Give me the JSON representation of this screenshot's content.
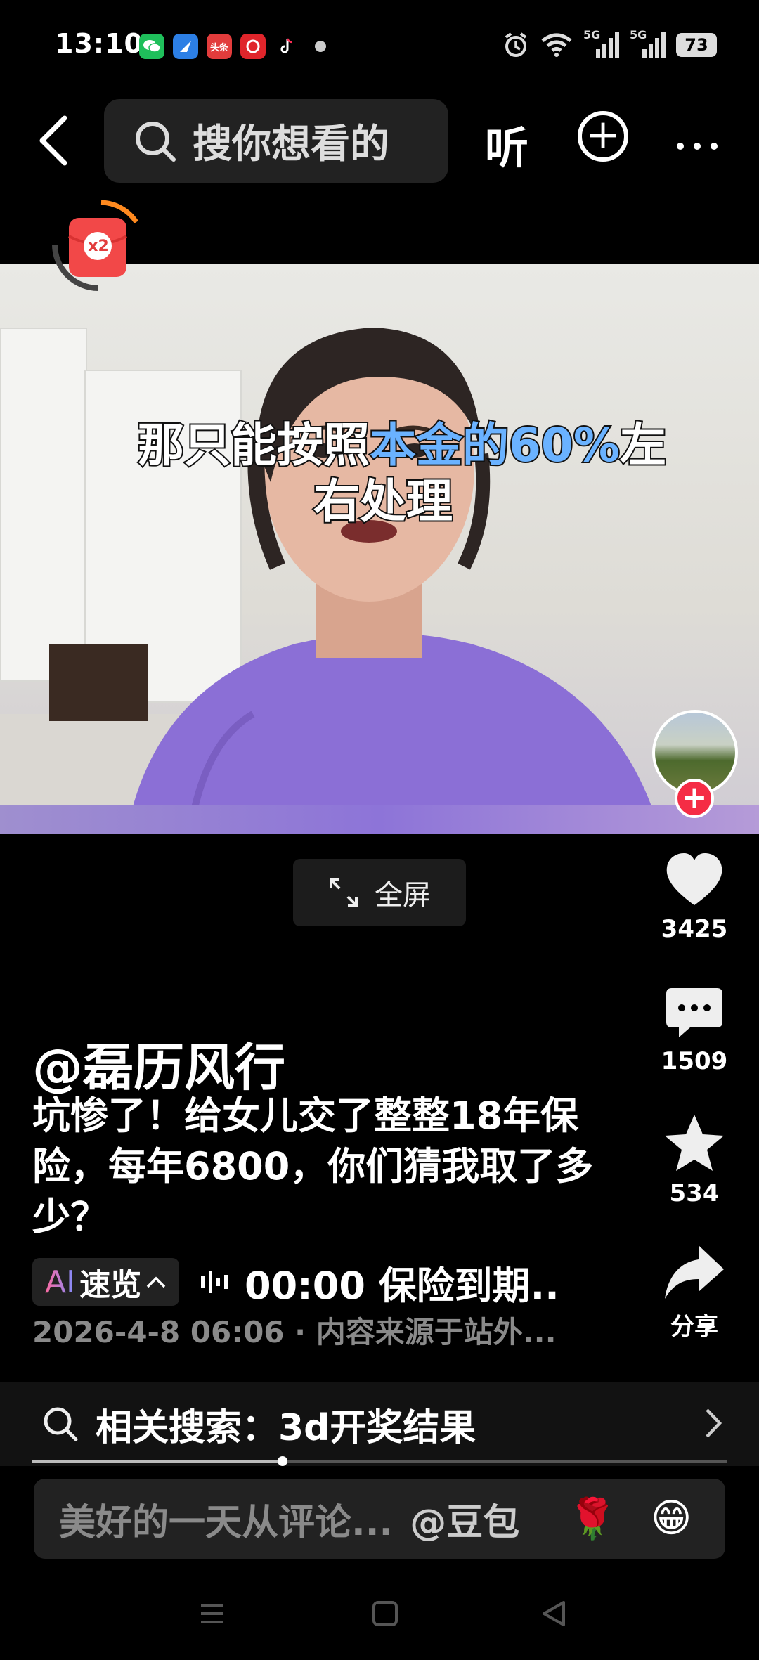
{
  "status_bar": {
    "time": "13:10",
    "apps": [
      {
        "name": "wechat-icon",
        "color": "#1fbf5b",
        "label": ""
      },
      {
        "name": "browser-icon",
        "color": "#2c7fe5",
        "label": ""
      },
      {
        "name": "toutiao-icon",
        "color": "#e23c3c",
        "label": "头条"
      },
      {
        "name": "gift-icon",
        "color": "#e0252b",
        "label": ""
      },
      {
        "name": "tiktok-icon",
        "color": "#111111",
        "label": ""
      }
    ],
    "network_1": "5G",
    "network_2": "5G",
    "battery": "73"
  },
  "top_nav": {
    "search_placeholder": "搜你想看的",
    "listen_label": "听"
  },
  "video": {
    "subtitle_line1_a": "那只能按照",
    "subtitle_line1_b": "本金的60%",
    "subtitle_line1_c": "左",
    "subtitle_line2": "右处理",
    "redpacket_badge": "x2"
  },
  "fullscreen_label": "全屏",
  "actions": {
    "likes": "3425",
    "comments": "1509",
    "favorites": "534",
    "share_label": "分享"
  },
  "post": {
    "author": "@磊历风行",
    "caption": "坑惨了！给女儿交了整整18年保险，每年6800，你们猜我取了多少？",
    "ai_label_a": "AI",
    "ai_label_b": "速览",
    "summary": "00:00 保险到期..",
    "meta": "2026-4-8 06:06 · 内容来源于站外..."
  },
  "related_search": {
    "label": "相关搜索：3d开奖结果",
    "progress": 0.36
  },
  "comment_bar": {
    "placeholder": "美好的一天从评论...",
    "mention": "@豆包"
  },
  "colors": {
    "accent_red": "#f52c45",
    "highlight_blue": "#6ab2ff"
  }
}
